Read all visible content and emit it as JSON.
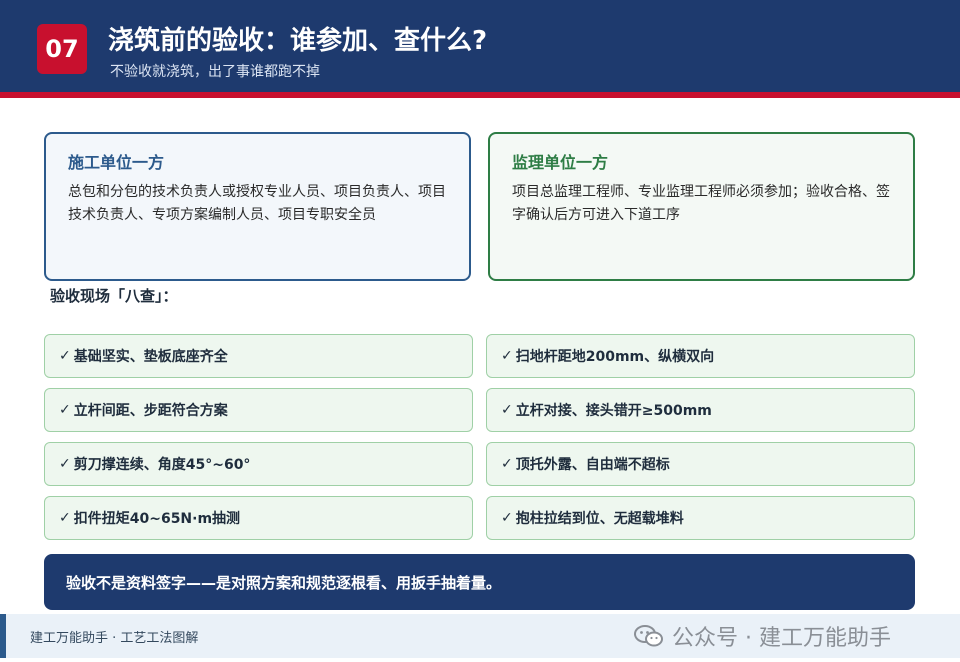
{
  "header": {
    "badge": "07",
    "title": "浇筑前的验收：谁参加、查什么?",
    "subtitle": "不验收就浇筑，出了事谁都跑不掉"
  },
  "parties": {
    "construction": {
      "title": "施工单位一方",
      "desc": "总包和分包的技术负责人或授权专业人员、项目负责人、项目技术负责人、专项方案编制人员、项目专职安全员"
    },
    "supervision": {
      "title": "监理单位一方",
      "desc": "项目总监理工程师、专业监理工程师必须参加；验收合格、签字确认后方可进入下道工序"
    }
  },
  "checks": {
    "label": "验收现场「八查」：",
    "check_glyph": "✓",
    "items": [
      "基础坚实、垫板底座齐全",
      "扫地杆距地200mm、纵横双向",
      "立杆间距、步距符合方案",
      "立杆对接、接头错开≥500mm",
      "剪刀撑连续、角度45°~60°",
      "顶托外露、自由端不超标",
      "扣件扭矩40~65N·m抽测",
      "抱柱拉结到位、无超载堆料"
    ]
  },
  "callout": "验收不是资料签字——是对照方案和规范逐根看、用扳手抽着量。",
  "footer": {
    "text": "建工万能助手 · 工艺工法图解",
    "watermark": "公众号 · 建工万能助手",
    "watermark_icon": "wechat-icon"
  },
  "colors": {
    "navy": "#1e3a6e",
    "red": "#c8102e",
    "green": "#2e7d45",
    "blue": "#2c5a8c"
  }
}
